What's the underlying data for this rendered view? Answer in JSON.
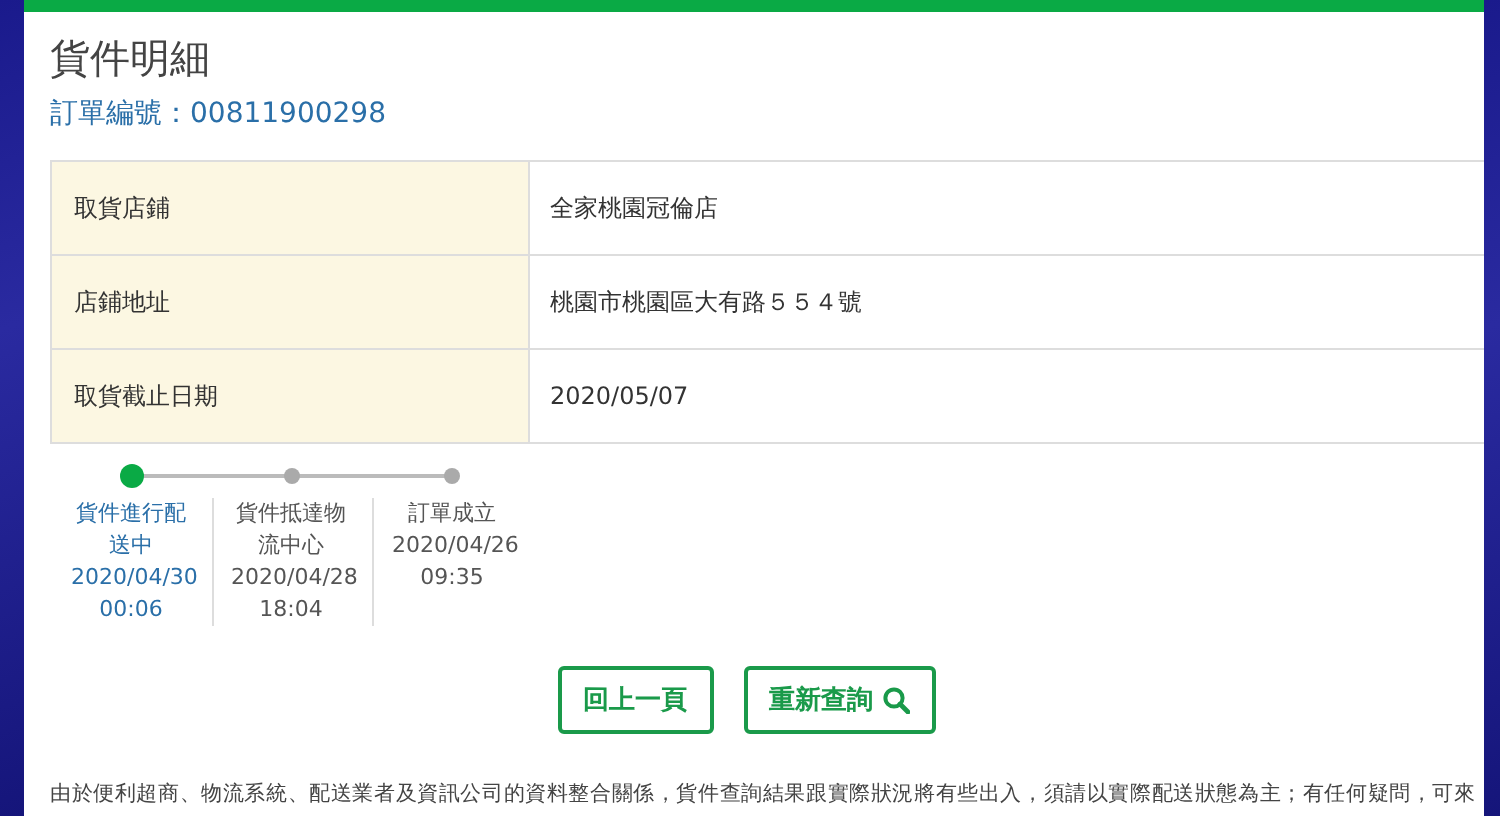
{
  "title": "貨件明細",
  "order_number": "訂單編號：00811900298",
  "details": [
    {
      "label": "取貨店鋪",
      "value": "全家桃園冠倫店"
    },
    {
      "label": "店鋪地址",
      "value": "桃園市桃園區大有路５５４號"
    },
    {
      "label": "取貨截止日期",
      "value": "2020/05/07"
    }
  ],
  "timeline": [
    {
      "status": "貨件進行配送中",
      "date": "2020/04/30",
      "time": "00:06",
      "selected": true
    },
    {
      "status": "貨件抵達物流中心",
      "date": "2020/04/28",
      "time": "18:04",
      "selected": false
    },
    {
      "status": "訂單成立",
      "date": "2020/04/26",
      "time": "09:35",
      "selected": false
    }
  ],
  "buttons": [
    {
      "label": "回上一頁",
      "kind": "plain"
    },
    {
      "label": "重新查詢",
      "kind": "search"
    }
  ],
  "notice": "由於便利超商、物流系統、配送業者及資訊公司的資料整合關係，貨件查詢結果跟實際狀況將有些出入，須請以實際配送狀態為主；有任何疑問，可來"
}
